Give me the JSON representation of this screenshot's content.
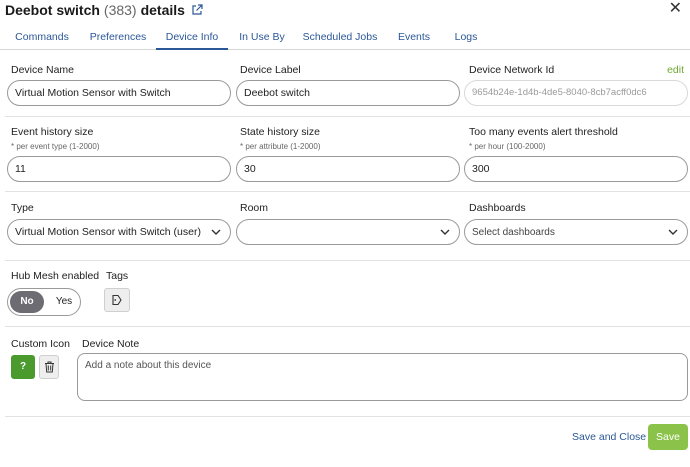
{
  "header": {
    "title": "Deebot switch",
    "device_count": "(383)",
    "suffix": "details"
  },
  "tabs": [
    {
      "label": "Commands"
    },
    {
      "label": "Preferences"
    },
    {
      "label": "Device Info",
      "active": true
    },
    {
      "label": "In Use By"
    },
    {
      "label": "Scheduled Jobs"
    },
    {
      "label": "Events"
    },
    {
      "label": "Logs"
    }
  ],
  "fields": {
    "device_name": {
      "label": "Device Name",
      "value": "Virtual Motion Sensor with Switch"
    },
    "device_label": {
      "label": "Device Label",
      "value": "Deebot switch"
    },
    "device_network_id": {
      "label": "Device Network Id",
      "value": "9654b24e-1d4b-4de5-8040-8cb7acff0dc6",
      "edit_label": "edit"
    },
    "event_history": {
      "label": "Event history size",
      "hint": "* per event type (1-2000)",
      "value": "11"
    },
    "state_history": {
      "label": "State history size",
      "hint": "* per attribute (1-2000)",
      "value": "30"
    },
    "too_many_events": {
      "label": "Too many events alert threshold",
      "hint": "* per hour (100-2000)",
      "value": "300"
    },
    "type": {
      "label": "Type",
      "value": "Virtual Motion Sensor with Switch (user)"
    },
    "room": {
      "label": "Room",
      "value": ""
    },
    "dashboards": {
      "label": "Dashboards",
      "placeholder": "Select dashboards"
    },
    "hub_mesh": {
      "label": "Hub Mesh enabled",
      "no": "No",
      "yes": "Yes",
      "selected": "No"
    },
    "tags": {
      "label": "Tags"
    },
    "custom_icon": {
      "label": "Custom Icon",
      "icon_text": "?"
    },
    "device_note": {
      "label": "Device Note",
      "placeholder": "Add a note about this device"
    }
  },
  "footer": {
    "save_close": "Save and Close",
    "save": "Save"
  },
  "colors": {
    "link_blue": "#2b5797",
    "save_green": "#8bc34a",
    "icon_green": "#4a9a2d",
    "edit_green": "#6fa834"
  },
  "icons": [
    "external-link-icon",
    "close-icon",
    "chevron-down-icon",
    "tag-add-icon",
    "trash-icon"
  ]
}
